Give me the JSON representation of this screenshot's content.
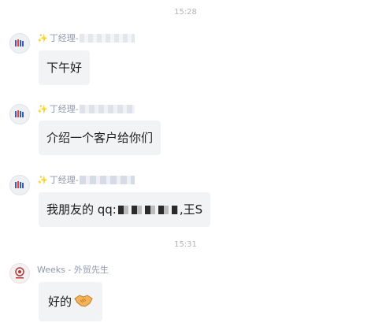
{
  "timestamps": [
    "15:28",
    "15:31"
  ],
  "messages": [
    {
      "sender": "丁经理-",
      "text": "下午好"
    },
    {
      "sender": "丁经理-",
      "text": "介绍一个客户给你们"
    },
    {
      "sender": "丁经理-",
      "text_prefix": "我朋友的 qq:",
      "text_suffix": ",王S"
    },
    {
      "sender": "Weeks - 外贸先生",
      "text": "好的"
    }
  ],
  "icons": {
    "sparkle": "✨",
    "handshake": "handshake-emoji"
  }
}
